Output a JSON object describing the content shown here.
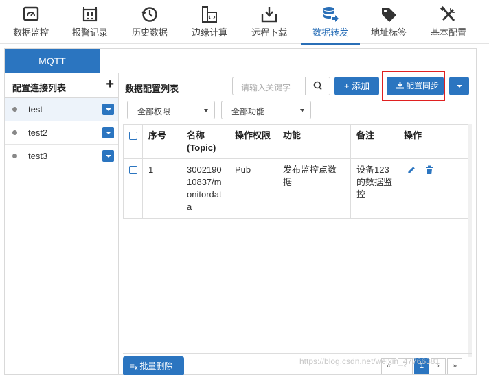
{
  "nav": [
    {
      "label": "数据监控",
      "icon": "monitor-gauge-icon"
    },
    {
      "label": "报警记录",
      "icon": "alarm-bell-icon"
    },
    {
      "label": "历史数据",
      "icon": "history-clock-icon"
    },
    {
      "label": "边缘计算",
      "icon": "edge-code-icon"
    },
    {
      "label": "远程下载",
      "icon": "download-icon"
    },
    {
      "label": "数据转发",
      "icon": "database-forward-icon"
    },
    {
      "label": "地址标签",
      "icon": "tag-icon"
    },
    {
      "label": "基本配置",
      "icon": "tools-icon"
    }
  ],
  "active_nav": "数据转发",
  "tabs": {
    "mqtt": "MQTT"
  },
  "left": {
    "title": "配置连接列表",
    "add_symbol": "+",
    "connections": [
      {
        "name": "test"
      },
      {
        "name": "test2"
      },
      {
        "name": "test3"
      }
    ]
  },
  "right": {
    "title": "数据配置列表",
    "search_placeholder": "请输入关键字",
    "add_label": "+ 添加",
    "sync_label": "配置同步",
    "filter_permission": "全部权限",
    "filter_function": "全部功能",
    "columns": [
      "序号",
      "名称(Topic)",
      "操作权限",
      "功能",
      "备注",
      "操作"
    ],
    "rows": [
      {
        "index": "1",
        "topic": "300219010837/monitordata",
        "permission": "Pub",
        "function": "发布监控点数据",
        "remark": "设备123的数据监控"
      }
    ],
    "batch_delete": "批量删除",
    "current_page": "1"
  },
  "watermark": "https://blog.csdn.net/weixin_47766381",
  "colors": {
    "accent": "#2b75c0",
    "highlight": "#e02020"
  }
}
